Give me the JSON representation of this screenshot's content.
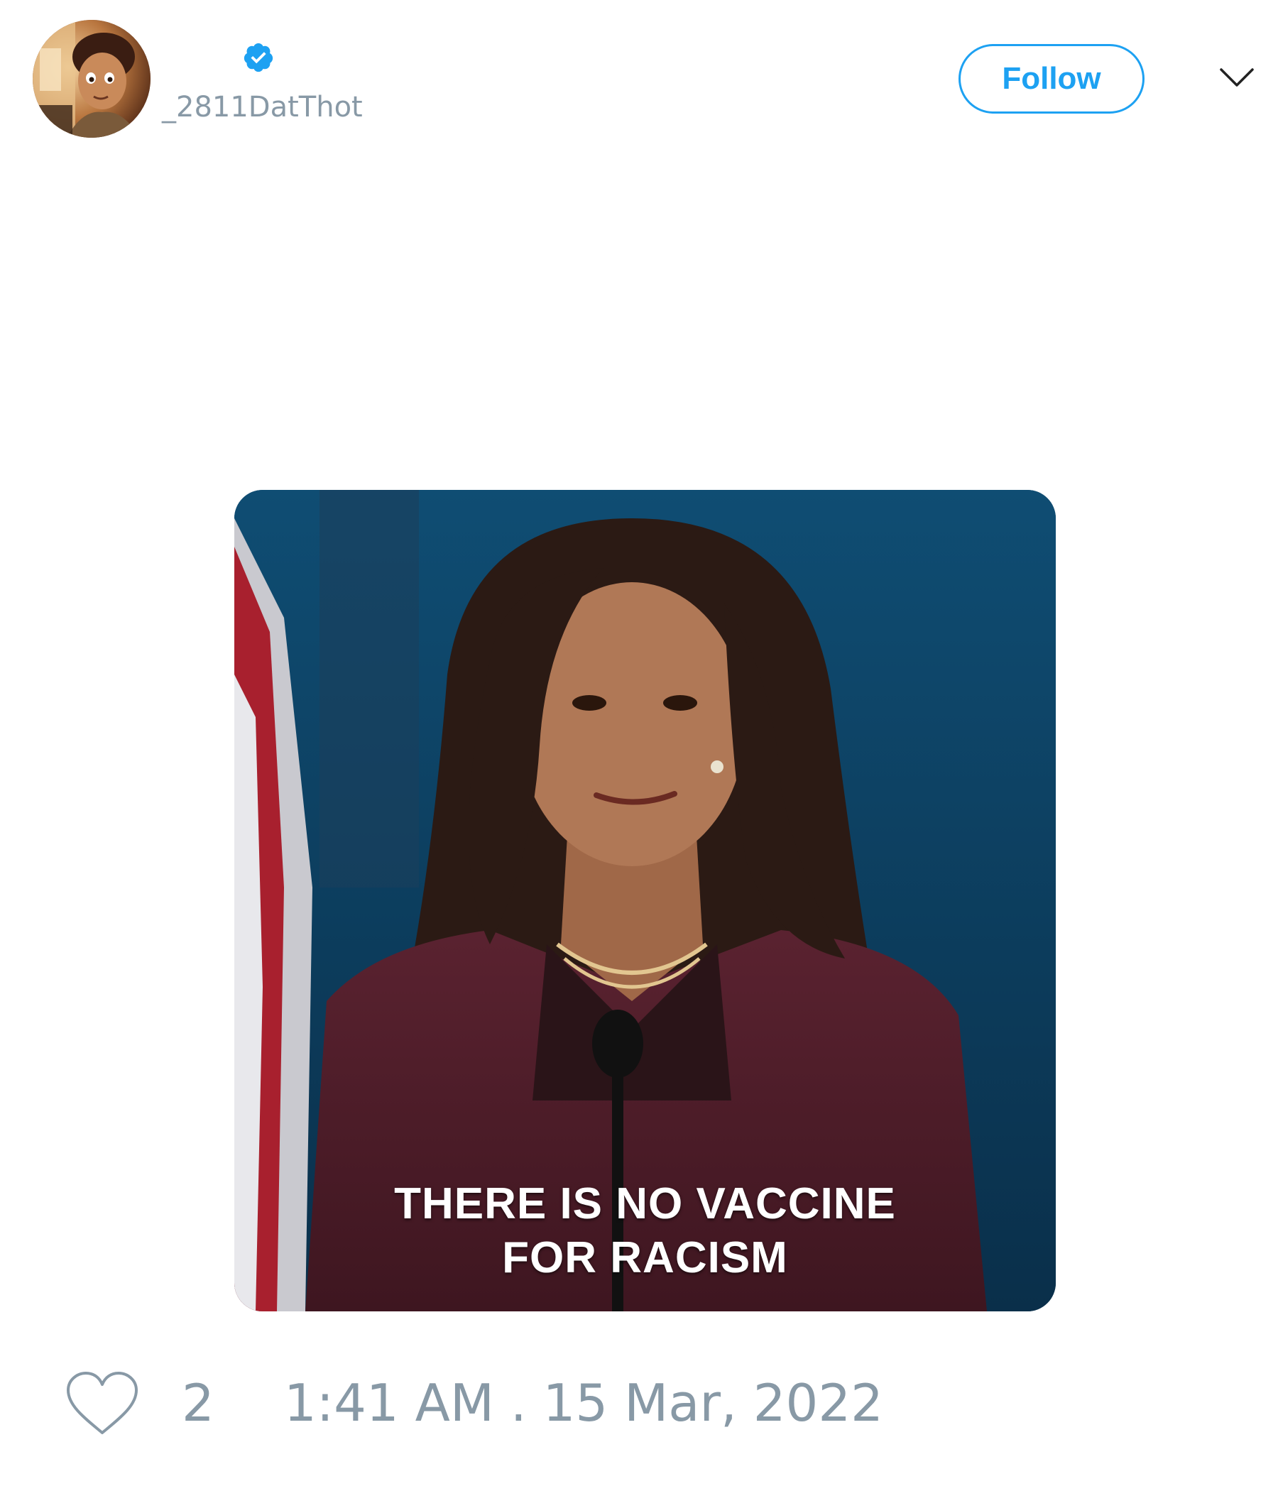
{
  "user": {
    "display_name": "",
    "handle": "_2811DatThot",
    "verified": true,
    "avatar_icon": "cartoon-avatar"
  },
  "header": {
    "follow_label": "Follow",
    "menu_icon": "chevron-down-icon"
  },
  "media": {
    "type": "gif",
    "caption_line1": "THERE IS NO VACCINE",
    "caption_line2": "FOR RACISM"
  },
  "footer": {
    "like_icon": "heart-icon",
    "like_count": "2",
    "timestamp": "1:41 AM . 15 Mar, 2022"
  },
  "colors": {
    "accent": "#1da1f2",
    "muted_text": "#8899a6",
    "background": "#ffffff"
  }
}
